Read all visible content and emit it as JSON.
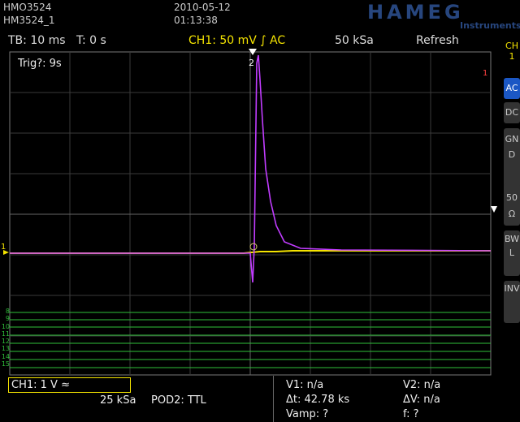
{
  "header": {
    "model": "HMO3524",
    "name": "HM3524_1",
    "date": "2010-05-12",
    "time": "01:13:38",
    "brand": "HAMEG",
    "brand_sub": "Instruments"
  },
  "status": {
    "timebase": "TB: 10 ms",
    "trigger_time": "T: 0 s",
    "channel": "CH1: 50 mV ∫ AC",
    "sample_rate": "50 kSa",
    "mode": "Refresh"
  },
  "screen": {
    "trigger_status": "Trig?: 9s",
    "ch_marker": "1",
    "trig_marker": "2",
    "ref_marker": "1"
  },
  "side_menu": {
    "ch_label": "CH\n1",
    "buttons": [
      "AC",
      "DC",
      "GND",
      "50Ω",
      "BWL",
      "INV"
    ]
  },
  "digital_channels": [
    "8",
    "9",
    "10",
    "11",
    "12",
    "13",
    "14",
    "15"
  ],
  "bottom": {
    "ch1_setting": "CH1: 1 V ≈",
    "sample_rate": "25 kSa",
    "pod": "POD2: TTL",
    "v1": "V1: n/a",
    "v2": "V2: n/a",
    "dt": "Δt: 42.78 ks",
    "dv": "ΔV: n/a",
    "vamp": "Vamp: ?",
    "freq": "f: ?"
  },
  "colors": {
    "trace_ch1": "#f5e400",
    "trace_ch2": "#c13cff",
    "digital": "#2fbf3a",
    "accent": "#1b57c4"
  }
}
